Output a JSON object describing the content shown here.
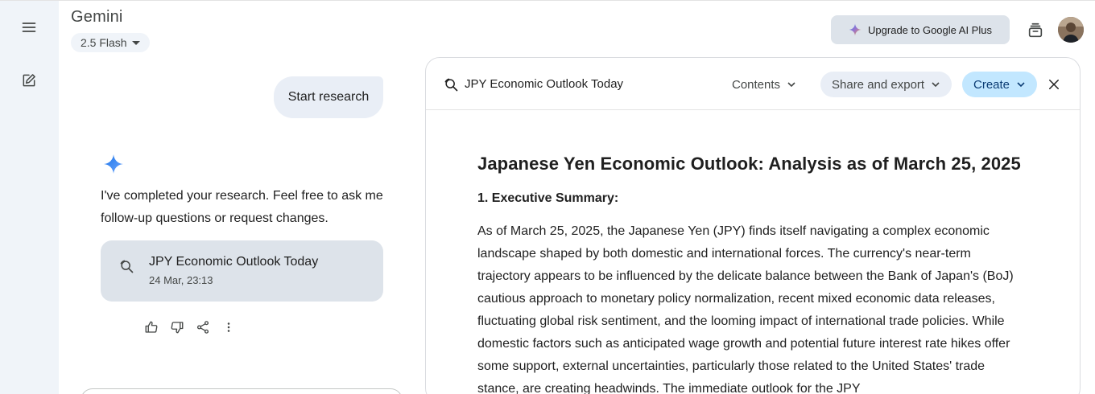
{
  "app": {
    "title": "Gemini",
    "model_label": "2.5 Flash"
  },
  "header": {
    "upgrade_label": "Upgrade to Google AI Plus"
  },
  "chat": {
    "user_message": "Start research",
    "reply": "I've completed your research. Feel free to ask me follow-up questions or request changes.",
    "card": {
      "title": "JPY Economic Outlook Today",
      "date": "24 Mar, 23:13"
    }
  },
  "doc": {
    "title": "JPY Economic Outlook Today",
    "contents_label": "Contents",
    "share_label": "Share and export",
    "create_label": "Create",
    "heading": "Japanese Yen Economic Outlook: Analysis as of March 25, 2025",
    "section1": "1. Executive Summary:",
    "paragraph": "As of March 25, 2025, the Japanese Yen (JPY) finds itself navigating a complex economic landscape shaped by both domestic and international forces. The currency's near-term trajectory appears to be influenced by the delicate balance between the Bank of Japan's (BoJ) cautious approach to monetary policy normalization, recent mixed economic data releases, fluctuating global risk sentiment, and the looming impact of international trade policies. While domestic factors such as anticipated wage growth and potential future interest rate hikes offer some support, external uncertainties, particularly those related to the United States' trade stance, are creating headwinds. The immediate outlook for the JPY"
  },
  "icons": {
    "menu": "menu-icon",
    "new_chat": "edit-icon",
    "upgrade": "sparkle-icon",
    "history": "history-icon",
    "research": "research-search-icon",
    "gemini": "gemini-spark-icon",
    "thumbs_up": "thumbs-up-icon",
    "thumbs_down": "thumbs-down-icon",
    "share": "share-icon",
    "more": "more-vert-icon",
    "chevron": "chevron-down-icon",
    "close": "close-icon"
  },
  "colors": {
    "rail_bg": "#f0f4f9",
    "create_bg": "#c2e7ff",
    "card_bg": "#dde3ea",
    "spark_blue": "#4285f4"
  }
}
